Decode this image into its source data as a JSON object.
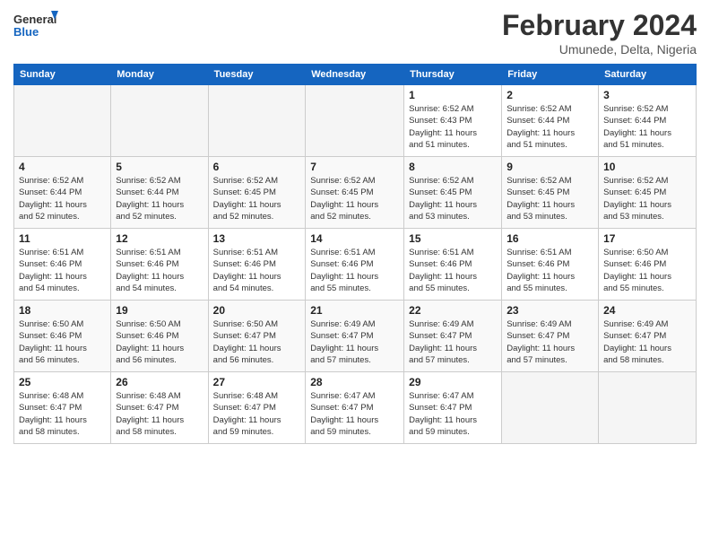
{
  "logo": {
    "line1": "General",
    "line2": "Blue"
  },
  "title": "February 2024",
  "location": "Umunede, Delta, Nigeria",
  "headers": [
    "Sunday",
    "Monday",
    "Tuesday",
    "Wednesday",
    "Thursday",
    "Friday",
    "Saturday"
  ],
  "weeks": [
    [
      {
        "day": "",
        "info": ""
      },
      {
        "day": "",
        "info": ""
      },
      {
        "day": "",
        "info": ""
      },
      {
        "day": "",
        "info": ""
      },
      {
        "day": "1",
        "info": "Sunrise: 6:52 AM\nSunset: 6:43 PM\nDaylight: 11 hours\nand 51 minutes."
      },
      {
        "day": "2",
        "info": "Sunrise: 6:52 AM\nSunset: 6:44 PM\nDaylight: 11 hours\nand 51 minutes."
      },
      {
        "day": "3",
        "info": "Sunrise: 6:52 AM\nSunset: 6:44 PM\nDaylight: 11 hours\nand 51 minutes."
      }
    ],
    [
      {
        "day": "4",
        "info": "Sunrise: 6:52 AM\nSunset: 6:44 PM\nDaylight: 11 hours\nand 52 minutes."
      },
      {
        "day": "5",
        "info": "Sunrise: 6:52 AM\nSunset: 6:44 PM\nDaylight: 11 hours\nand 52 minutes."
      },
      {
        "day": "6",
        "info": "Sunrise: 6:52 AM\nSunset: 6:45 PM\nDaylight: 11 hours\nand 52 minutes."
      },
      {
        "day": "7",
        "info": "Sunrise: 6:52 AM\nSunset: 6:45 PM\nDaylight: 11 hours\nand 52 minutes."
      },
      {
        "day": "8",
        "info": "Sunrise: 6:52 AM\nSunset: 6:45 PM\nDaylight: 11 hours\nand 53 minutes."
      },
      {
        "day": "9",
        "info": "Sunrise: 6:52 AM\nSunset: 6:45 PM\nDaylight: 11 hours\nand 53 minutes."
      },
      {
        "day": "10",
        "info": "Sunrise: 6:52 AM\nSunset: 6:45 PM\nDaylight: 11 hours\nand 53 minutes."
      }
    ],
    [
      {
        "day": "11",
        "info": "Sunrise: 6:51 AM\nSunset: 6:46 PM\nDaylight: 11 hours\nand 54 minutes."
      },
      {
        "day": "12",
        "info": "Sunrise: 6:51 AM\nSunset: 6:46 PM\nDaylight: 11 hours\nand 54 minutes."
      },
      {
        "day": "13",
        "info": "Sunrise: 6:51 AM\nSunset: 6:46 PM\nDaylight: 11 hours\nand 54 minutes."
      },
      {
        "day": "14",
        "info": "Sunrise: 6:51 AM\nSunset: 6:46 PM\nDaylight: 11 hours\nand 55 minutes."
      },
      {
        "day": "15",
        "info": "Sunrise: 6:51 AM\nSunset: 6:46 PM\nDaylight: 11 hours\nand 55 minutes."
      },
      {
        "day": "16",
        "info": "Sunrise: 6:51 AM\nSunset: 6:46 PM\nDaylight: 11 hours\nand 55 minutes."
      },
      {
        "day": "17",
        "info": "Sunrise: 6:50 AM\nSunset: 6:46 PM\nDaylight: 11 hours\nand 55 minutes."
      }
    ],
    [
      {
        "day": "18",
        "info": "Sunrise: 6:50 AM\nSunset: 6:46 PM\nDaylight: 11 hours\nand 56 minutes."
      },
      {
        "day": "19",
        "info": "Sunrise: 6:50 AM\nSunset: 6:46 PM\nDaylight: 11 hours\nand 56 minutes."
      },
      {
        "day": "20",
        "info": "Sunrise: 6:50 AM\nSunset: 6:47 PM\nDaylight: 11 hours\nand 56 minutes."
      },
      {
        "day": "21",
        "info": "Sunrise: 6:49 AM\nSunset: 6:47 PM\nDaylight: 11 hours\nand 57 minutes."
      },
      {
        "day": "22",
        "info": "Sunrise: 6:49 AM\nSunset: 6:47 PM\nDaylight: 11 hours\nand 57 minutes."
      },
      {
        "day": "23",
        "info": "Sunrise: 6:49 AM\nSunset: 6:47 PM\nDaylight: 11 hours\nand 57 minutes."
      },
      {
        "day": "24",
        "info": "Sunrise: 6:49 AM\nSunset: 6:47 PM\nDaylight: 11 hours\nand 58 minutes."
      }
    ],
    [
      {
        "day": "25",
        "info": "Sunrise: 6:48 AM\nSunset: 6:47 PM\nDaylight: 11 hours\nand 58 minutes."
      },
      {
        "day": "26",
        "info": "Sunrise: 6:48 AM\nSunset: 6:47 PM\nDaylight: 11 hours\nand 58 minutes."
      },
      {
        "day": "27",
        "info": "Sunrise: 6:48 AM\nSunset: 6:47 PM\nDaylight: 11 hours\nand 59 minutes."
      },
      {
        "day": "28",
        "info": "Sunrise: 6:47 AM\nSunset: 6:47 PM\nDaylight: 11 hours\nand 59 minutes."
      },
      {
        "day": "29",
        "info": "Sunrise: 6:47 AM\nSunset: 6:47 PM\nDaylight: 11 hours\nand 59 minutes."
      },
      {
        "day": "",
        "info": ""
      },
      {
        "day": "",
        "info": ""
      }
    ]
  ]
}
